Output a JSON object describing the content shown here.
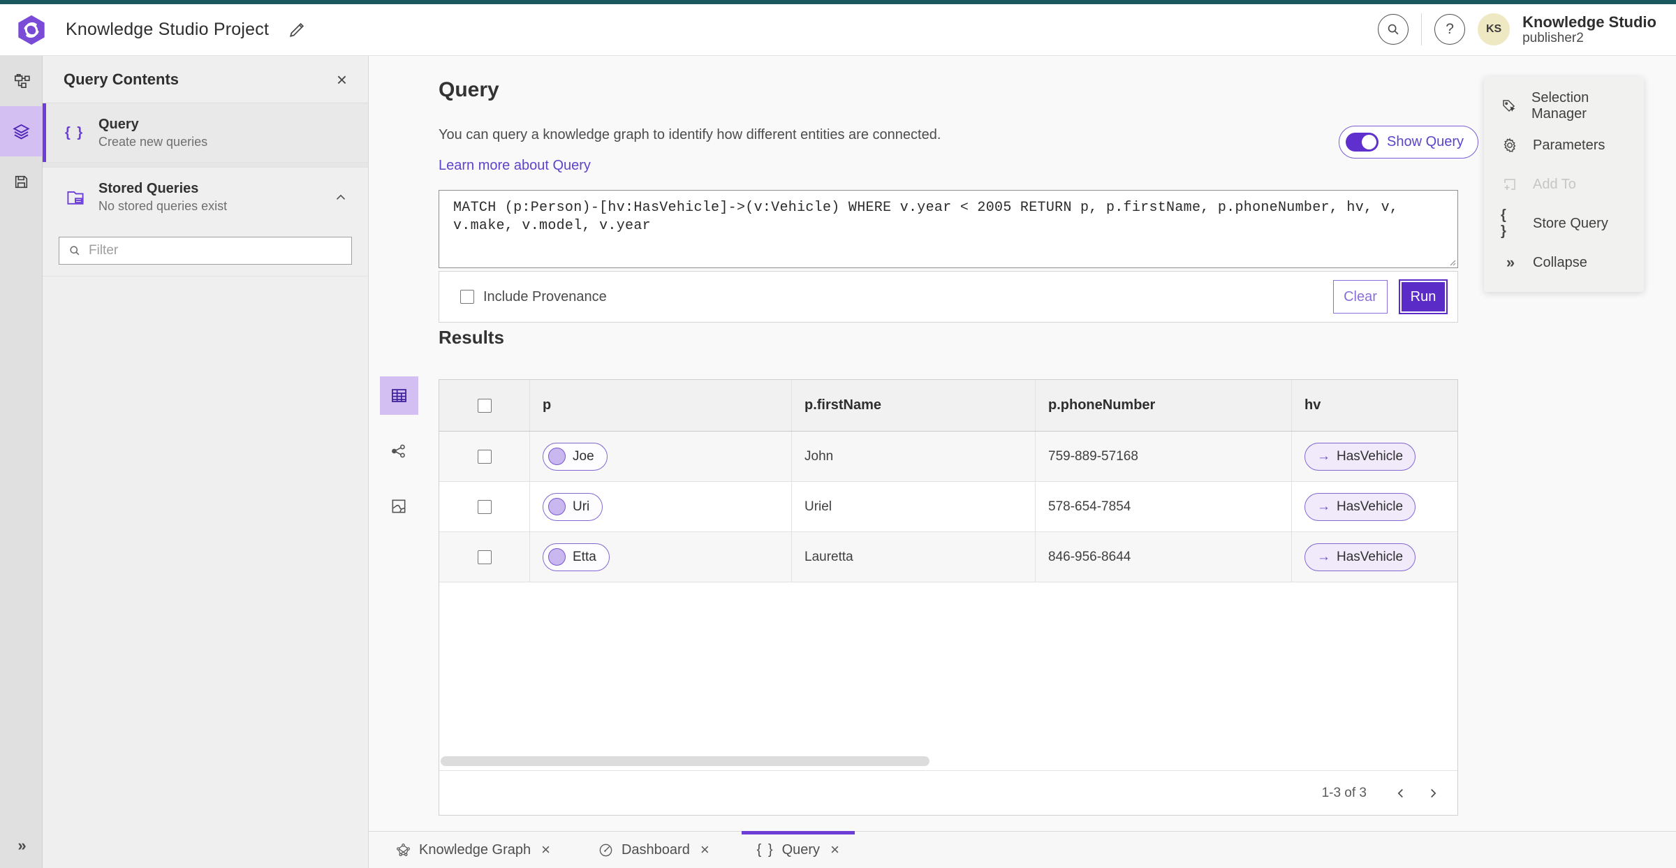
{
  "app": {
    "title": "Knowledge Studio Project",
    "user": {
      "initials": "KS",
      "name": "Knowledge Studio",
      "role": "publisher2"
    }
  },
  "glyphs": {
    "braces": "{ }",
    "close": "×",
    "collapse_chevrons": "»",
    "arrow_right": "→",
    "help": "?"
  },
  "left_panel": {
    "title": "Query Contents",
    "query_item": {
      "label": "Query",
      "sublabel": "Create new queries"
    },
    "stored_item": {
      "label": "Stored Queries",
      "sublabel": "No stored queries exist"
    },
    "filter_placeholder": "Filter"
  },
  "query_section": {
    "title": "Query",
    "description": "You can query a knowledge graph to identify how different entities are connected.",
    "link_label": "Learn more about Query",
    "show_query_label": "Show Query",
    "query_text": "MATCH (p:Person)-[hv:HasVehicle]->(v:Vehicle) WHERE v.year < 2005 RETURN p, p.firstName, p.phoneNumber, hv, v, v.make, v.model, v.year",
    "include_provenance_label": "Include Provenance",
    "clear_label": "Clear",
    "run_label": "Run"
  },
  "right_menu": {
    "items": [
      {
        "label": "Selection Manager",
        "disabled": false
      },
      {
        "label": "Parameters",
        "disabled": false
      },
      {
        "label": "Add To",
        "disabled": true
      },
      {
        "label": "Store Query",
        "disabled": false
      },
      {
        "label": "Collapse",
        "disabled": false
      }
    ]
  },
  "results": {
    "title": "Results",
    "columns": [
      "p",
      "p.firstName",
      "p.phoneNumber",
      "hv"
    ],
    "rows": [
      {
        "p": "Joe",
        "first_name": "John",
        "phone": "759-889-57168",
        "hv": "HasVehicle"
      },
      {
        "p": "Uri",
        "first_name": "Uriel",
        "phone": "578-654-7854",
        "hv": "HasVehicle"
      },
      {
        "p": "Etta",
        "first_name": "Lauretta",
        "phone": "846-956-8644",
        "hv": "HasVehicle"
      }
    ],
    "pagination_label": "1-3 of 3"
  },
  "tabs": [
    {
      "label": "Knowledge Graph",
      "active": false
    },
    {
      "label": "Dashboard",
      "active": false
    },
    {
      "label": "Query",
      "active": true
    }
  ],
  "colors": {
    "top_strip_teal": "#1a585f",
    "accent_purple": "#5b2bc7",
    "accent_purple_light": "#d3bff2",
    "link_purple": "#5f43c9",
    "pill_border_purple": "#8266d2",
    "avatar_yellow": "#efe9c3"
  }
}
